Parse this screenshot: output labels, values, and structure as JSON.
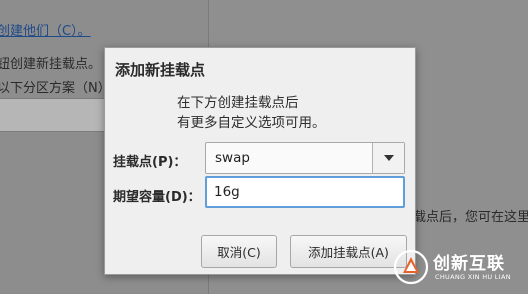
{
  "background": {
    "link_text": "创建他们（C）。",
    "line1": "钮创建新挂载点。",
    "line2": "以下分区方案（N）",
    "right_text": "载点后，您可在这里"
  },
  "dialog": {
    "title": "添加新挂载点",
    "description_line1": "在下方创建挂载点后",
    "description_line2": "有更多自定义选项可用。",
    "mount_point_label": "挂载点(P)：",
    "mount_point_value": "swap",
    "capacity_label": "期望容量(D)：",
    "capacity_value": "16g",
    "cancel_label": "取消(C)",
    "add_label": "添加挂载点(A)"
  },
  "watermark": {
    "name": "创新互联",
    "pinyin": "CHUANG XIN HU LIAN"
  },
  "colors": {
    "focus_border": "#5f9edb",
    "link": "#1f4a8a"
  }
}
